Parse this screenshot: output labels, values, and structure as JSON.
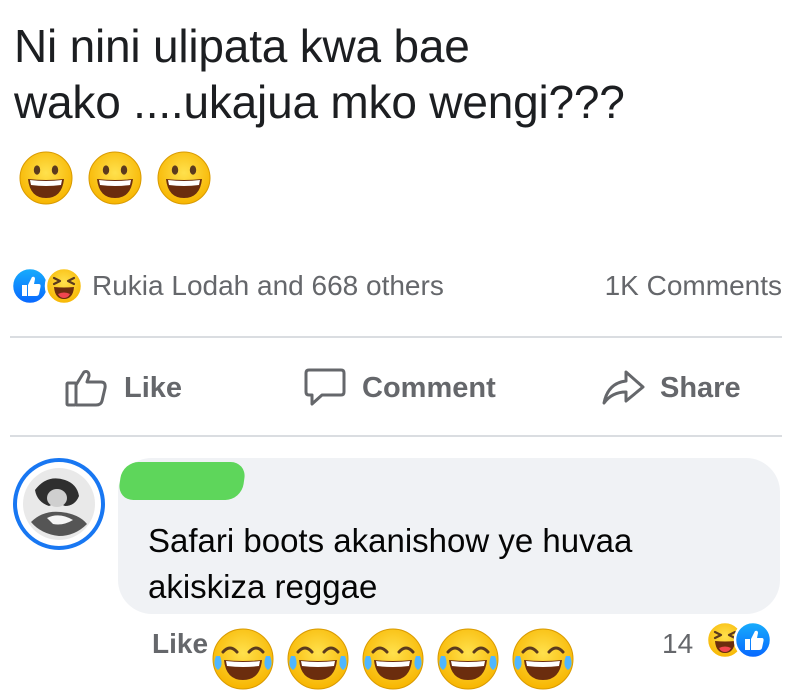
{
  "post": {
    "text_line1": "Ni nini ulipata kwa bae",
    "text_line2": "wako ....ukajua mko wengi???",
    "emojis": [
      "grinning-face-icon",
      "grinning-face-icon",
      "grinning-face-icon"
    ]
  },
  "reactions": {
    "icons": [
      "like-reaction-icon",
      "haha-reaction-icon"
    ],
    "summary": "Rukia Lodah and 668 others",
    "comments_count": "1K Comments"
  },
  "actions": {
    "like": "Like",
    "comment": "Comment",
    "share": "Share"
  },
  "comment": {
    "text": "Safari boots akanishow ye huvaa akiskiza reggae",
    "like_label": "Like",
    "emojis": [
      "crying-laughing-icon",
      "crying-laughing-icon",
      "crying-laughing-icon",
      "crying-laughing-icon",
      "crying-laughing-icon"
    ],
    "reaction_count": "14",
    "reaction_icons": [
      "haha-reaction-icon",
      "like-reaction-icon"
    ]
  },
  "colors": {
    "brand_blue": "#1877f2",
    "muted_text": "#65676b",
    "bubble_bg": "#f0f2f5",
    "emoji_yellow": "#ffcc33",
    "redaction_green": "#5ed65b"
  }
}
